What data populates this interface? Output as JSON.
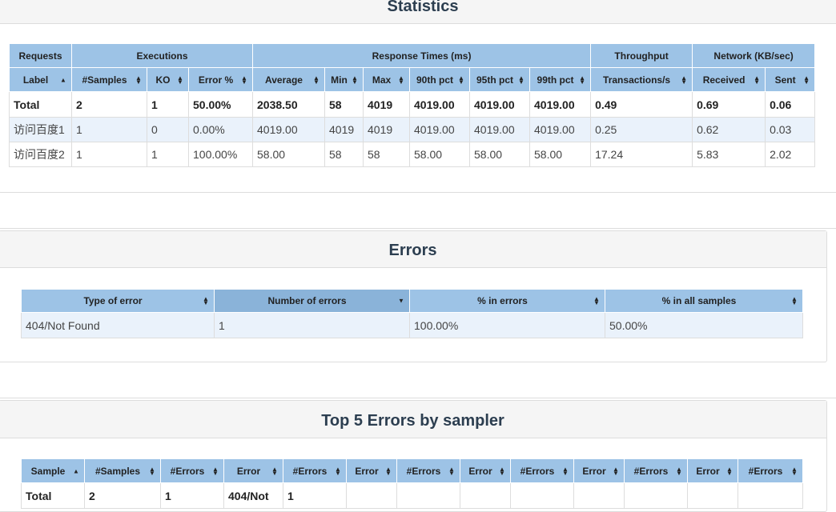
{
  "statistics": {
    "title": "Statistics",
    "group_headers": [
      "Requests",
      "Executions",
      "Response Times (ms)",
      "Throughput",
      "Network (KB/sec)"
    ],
    "columns": [
      "Label",
      "#Samples",
      "KO",
      "Error %",
      "Average",
      "Min",
      "Max",
      "90th pct",
      "95th pct",
      "99th pct",
      "Transactions/s",
      "Received",
      "Sent"
    ],
    "sorted_column": "Label",
    "sorted_direction": "asc",
    "total": [
      "Total",
      "2",
      "1",
      "50.00%",
      "2038.50",
      "58",
      "4019",
      "4019.00",
      "4019.00",
      "4019.00",
      "0.49",
      "0.69",
      "0.06"
    ],
    "rows": [
      [
        "访问百度1",
        "1",
        "0",
        "0.00%",
        "4019.00",
        "4019",
        "4019",
        "4019.00",
        "4019.00",
        "4019.00",
        "0.25",
        "0.62",
        "0.03"
      ],
      [
        "访问百度2",
        "1",
        "1",
        "100.00%",
        "58.00",
        "58",
        "58",
        "58.00",
        "58.00",
        "58.00",
        "17.24",
        "5.83",
        "2.02"
      ]
    ]
  },
  "errors": {
    "title": "Errors",
    "columns": [
      "Type of error",
      "Number of errors",
      "% in errors",
      "% in all samples"
    ],
    "sorted_column": "Number of errors",
    "sorted_direction": "desc",
    "rows": [
      [
        "404/Not Found",
        "1",
        "100.00%",
        "50.00%"
      ]
    ]
  },
  "top_errors": {
    "title": "Top 5 Errors by sampler",
    "columns": [
      "Sample",
      "#Samples",
      "#Errors",
      "Error",
      "#Errors",
      "Error",
      "#Errors",
      "Error",
      "#Errors",
      "Error",
      "#Errors",
      "Error",
      "#Errors"
    ],
    "sorted_column": "Sample",
    "sorted_direction": "asc",
    "total": [
      "Total",
      "2",
      "1",
      "404/Not",
      "1",
      "",
      "",
      "",
      "",
      "",
      "",
      "",
      ""
    ]
  },
  "colors": {
    "header_bg": "#9dc3e6",
    "sorted_header_bg": "#8ab3d9",
    "odd_row_bg": "#eaf2fb",
    "panel_heading_bg": "#f5f5f5",
    "title_color": "#2c3e50"
  },
  "icons": {
    "sortable": "sort-both-icon",
    "asc": "sort-asc-icon",
    "desc": "sort-desc-icon"
  }
}
